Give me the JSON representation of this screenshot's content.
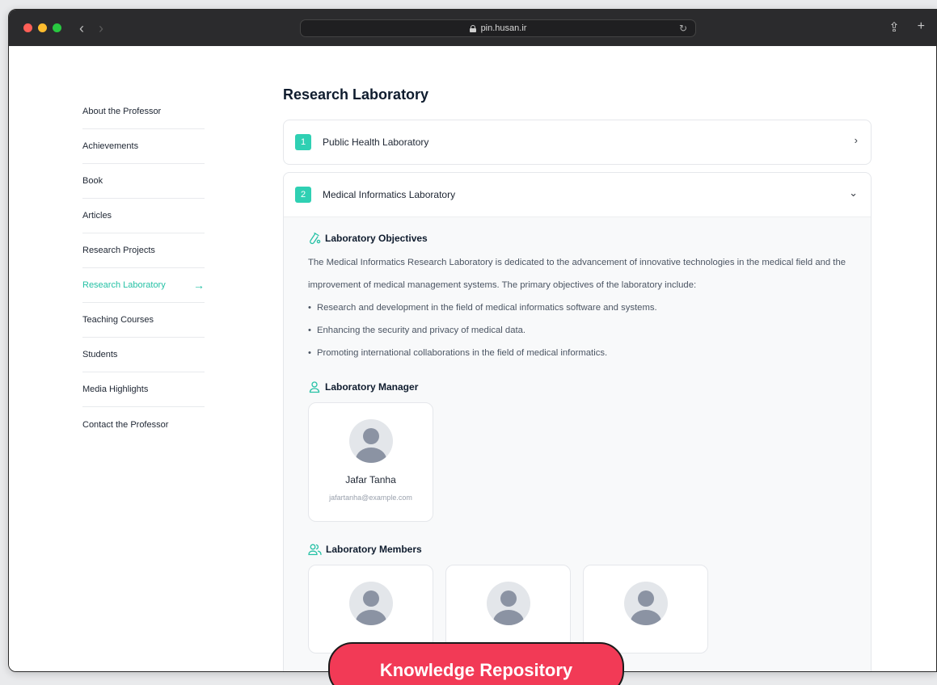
{
  "browser": {
    "url": "pin.husan.ir",
    "back_icon": "‹",
    "forward_icon": "›",
    "reload_icon": "↻",
    "share_icon": "⇪",
    "new_tab_icon": "+"
  },
  "sidebar": {
    "items": [
      {
        "label": "About the Professor"
      },
      {
        "label": "Achievements"
      },
      {
        "label": "Book"
      },
      {
        "label": "Articles"
      },
      {
        "label": "Research Projects"
      },
      {
        "label": "Research Laboratory",
        "active": true
      },
      {
        "label": "Teaching Courses"
      },
      {
        "label": "Students"
      },
      {
        "label": "Media Highlights"
      },
      {
        "label": "Contact the Professor"
      }
    ],
    "active_arrow": "→",
    "accent_color": "#25c1a5"
  },
  "main": {
    "title": "Research Laboratory",
    "labs": [
      {
        "number": "1",
        "name": "Public Health Laboratory",
        "expanded": false,
        "chevron": "›"
      },
      {
        "number": "2",
        "name": "Medical Informatics Laboratory",
        "expanded": true,
        "chevron": "⌄"
      }
    ],
    "objectives": {
      "heading": "Laboratory Objectives",
      "paragraph": "The Medical Informatics Research Laboratory is dedicated to the advancement of innovative technologies in the medical field and the improvement of medical management systems. The primary objectives of the laboratory include:",
      "bullets": [
        "Research and development in the field of medical informatics software and systems.",
        "Enhancing the security and privacy of medical data.",
        "Promoting international collaborations in the field of medical informatics."
      ]
    },
    "manager": {
      "heading": "Laboratory Manager",
      "name": "Jafar Tanha",
      "email": "jafartanha@example.com"
    },
    "members": {
      "heading": "Laboratory Members",
      "count_visible": 3
    }
  },
  "overlay_badge": {
    "label": "Knowledge Repository",
    "color": "#f23a56"
  }
}
